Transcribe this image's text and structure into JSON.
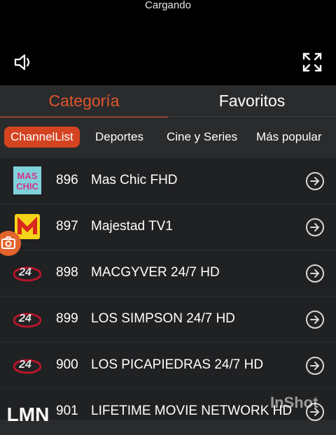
{
  "player": {
    "status": "Cargando"
  },
  "tabs": [
    {
      "label": "Categoría",
      "active": true
    },
    {
      "label": "Favoritos",
      "active": false
    }
  ],
  "subtabs": [
    {
      "label": "ChannelList",
      "active": true
    },
    {
      "label": "Deportes",
      "active": false
    },
    {
      "label": "Cine y Series",
      "active": false
    },
    {
      "label": "Más popular",
      "active": false
    }
  ],
  "channels": [
    {
      "number": "896",
      "name": "Mas Chic FHD",
      "logo": "maschic-logo",
      "logo_text": "MAS CHIC"
    },
    {
      "number": "897",
      "name": "Majestad TV1",
      "logo": "majestad-logo",
      "logo_text": "M"
    },
    {
      "number": "898",
      "name": "MACGYVER 24/7 HD",
      "logo": "24-7-logo",
      "logo_text": "24"
    },
    {
      "number": "899",
      "name": "LOS SIMPSON 24/7 HD",
      "logo": "24-7-logo",
      "logo_text": "24"
    },
    {
      "number": "900",
      "name": "LOS PICAPIEDRAS 24/7 HD",
      "logo": "24-7-logo",
      "logo_text": "24"
    },
    {
      "number": "901",
      "name": "LIFETIME MOVIE NETWORK HD",
      "logo": "lmn-logo",
      "logo_text": "LMN"
    }
  ],
  "watermark": "InShot",
  "colors": {
    "accent": "#e0562b",
    "active_chip": "#d44420",
    "background": "#2a2b2d",
    "list_bg": "#202123"
  },
  "icons": [
    "volume-icon",
    "fullscreen-icon",
    "arrow-right-circle-icon",
    "camera-icon"
  ]
}
